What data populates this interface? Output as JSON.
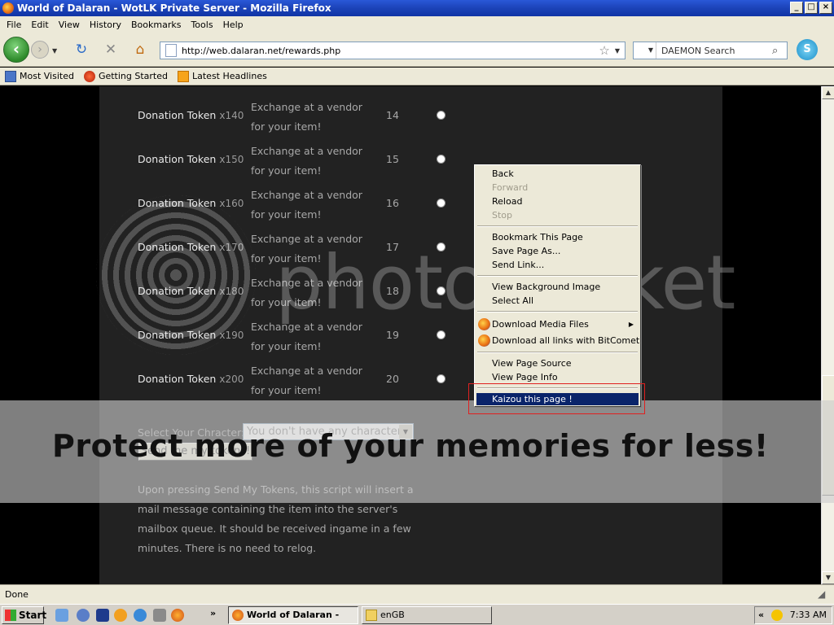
{
  "window": {
    "title": "World of Dalaran - WotLK Private Server - Mozilla Firefox",
    "min": "_",
    "max": "□",
    "close": "×"
  },
  "menu": [
    "File",
    "Edit",
    "View",
    "History",
    "Bookmarks",
    "Tools",
    "Help"
  ],
  "nav": {
    "url": "http://web.dalaran.net/rewards.php",
    "search_placeholder": "DAEMON Search"
  },
  "bookmarks": [
    "Most Visited",
    "Getting Started",
    "Latest Headlines"
  ],
  "rewards": [
    {
      "name": "Donation Token",
      "qty": "x140",
      "desc": "Exchange at a vendor for your item!",
      "cost": "14"
    },
    {
      "name": "Donation Token",
      "qty": "x150",
      "desc": "Exchange at a vendor for your item!",
      "cost": "15"
    },
    {
      "name": "Donation Token",
      "qty": "x160",
      "desc": "Exchange at a vendor for your item!",
      "cost": "16"
    },
    {
      "name": "Donation Token",
      "qty": "x170",
      "desc": "Exchange at a vendor for your item!",
      "cost": "17"
    },
    {
      "name": "Donation Token",
      "qty": "x180",
      "desc": "Exchange at a vendor for your item!",
      "cost": "18"
    },
    {
      "name": "Donation Token",
      "qty": "x190",
      "desc": "Exchange at a vendor for your item!",
      "cost": "19"
    },
    {
      "name": "Donation Token",
      "qty": "x200",
      "desc": "Exchange at a vendor for your item!",
      "cost": "20"
    }
  ],
  "form": {
    "select_label": "Select Your Chracter:",
    "select_value": "You don't have any characters",
    "send_button": "Send me my tokens!",
    "info": "Upon pressing Send My Tokens, this script will insert a mail message containing the item into the server's mailbox queue. It should be received ingame in a few minutes. There is no need to relog."
  },
  "context_menu": {
    "back": "Back",
    "forward": "Forward",
    "reload": "Reload",
    "stop": "Stop",
    "bookmark": "Bookmark This Page",
    "save": "Save Page As...",
    "send_link": "Send Link...",
    "view_bg": "View Background Image",
    "select_all": "Select All",
    "download_media": "Download Media Files",
    "download_bitcomet": "Download all links with BitComet",
    "view_source": "View Page Source",
    "view_info": "View Page Info",
    "kaizou": "Kaizou this page !"
  },
  "watermark": {
    "brand": "photobucket",
    "tagline": "Protect more of your memories for less!"
  },
  "status": "Done",
  "taskbar": {
    "start": "Start",
    "tasks": [
      "World of Dalaran - Wo...",
      "enGB"
    ],
    "clock": "7:33 AM",
    "chevron": "«",
    "ql_more": "»"
  }
}
